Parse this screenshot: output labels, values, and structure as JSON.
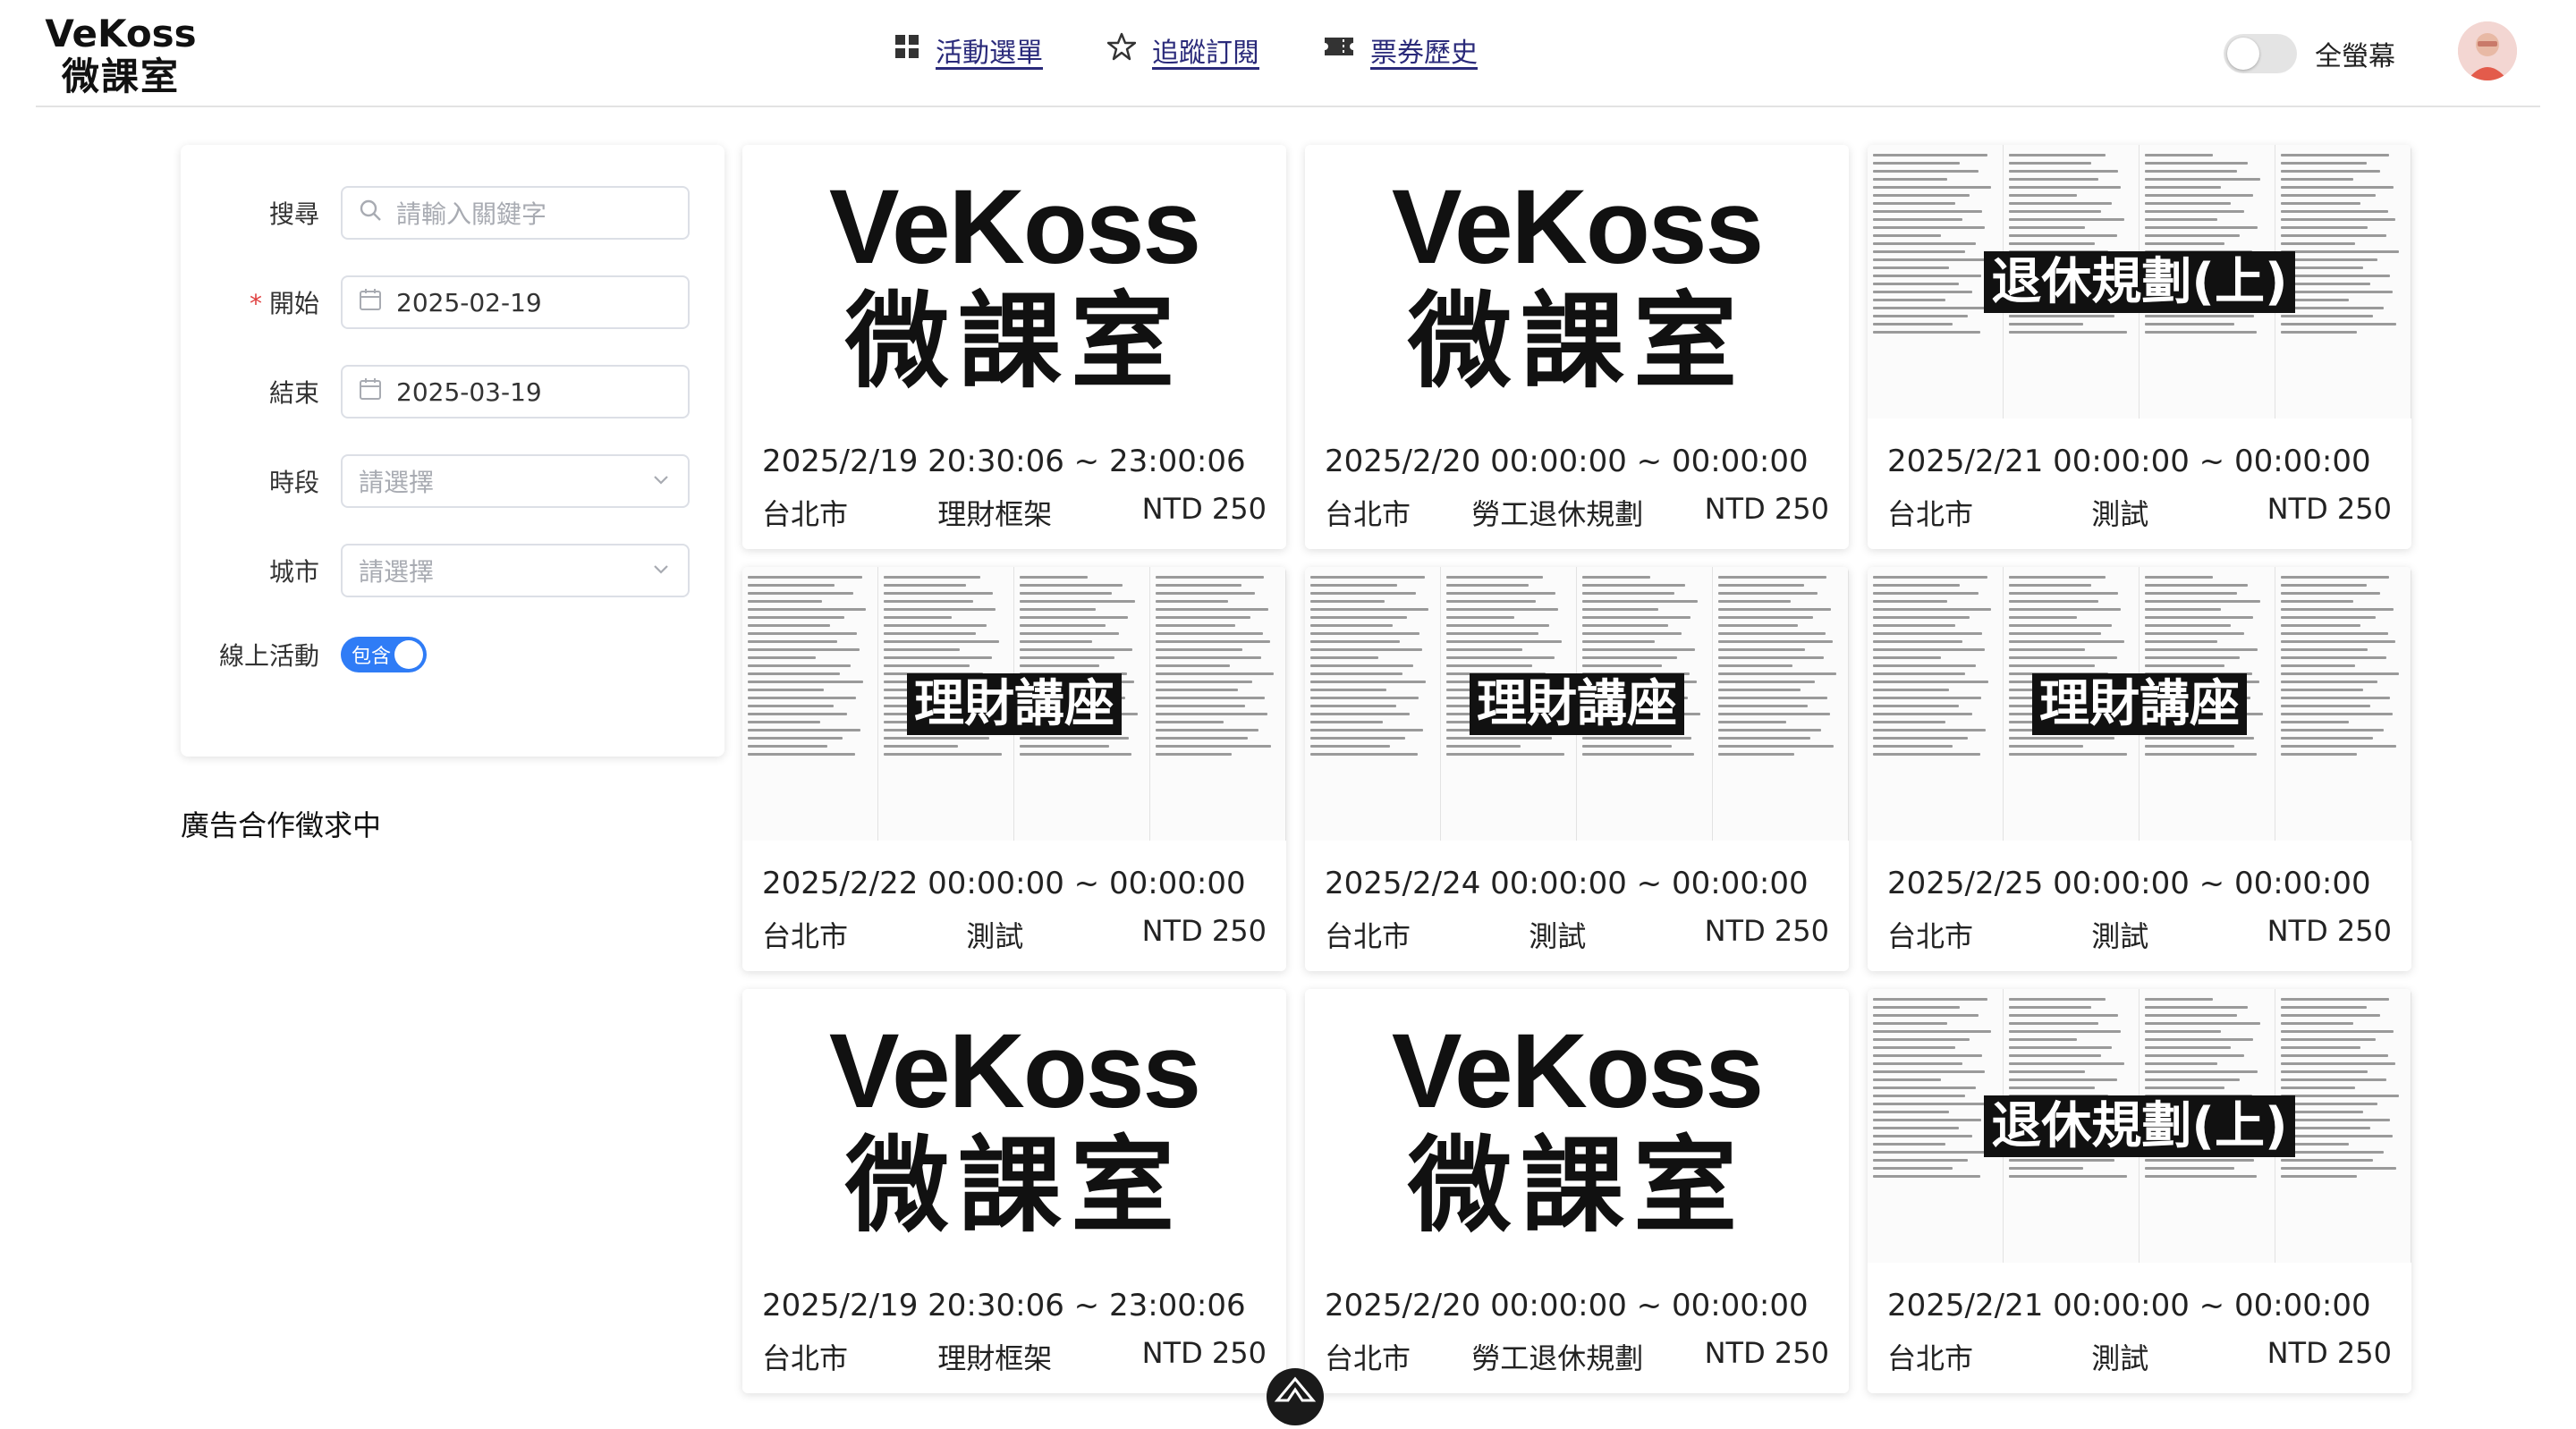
{
  "header": {
    "logo_line1": "VeKoss",
    "logo_line2": "微課室",
    "nav": [
      {
        "label": "活動選單",
        "icon": "grid-icon"
      },
      {
        "label": "追蹤訂閱",
        "icon": "star-icon"
      },
      {
        "label": "票券歷史",
        "icon": "ticket-icon"
      }
    ],
    "fullscreen_label": "全螢幕",
    "fullscreen_on": false
  },
  "filters": {
    "search": {
      "label": "搜尋",
      "placeholder": "請輸入關鍵字"
    },
    "start": {
      "label": "開始",
      "required_mark": "*",
      "value": "2025-02-19"
    },
    "end": {
      "label": "結束",
      "value": "2025-03-19"
    },
    "period": {
      "label": "時段",
      "placeholder": "請選擇"
    },
    "city": {
      "label": "城市",
      "placeholder": "請選擇"
    },
    "online": {
      "label": "線上活動",
      "toggle_text": "包含",
      "on": true
    }
  },
  "ad_text": "廣告合作徵求中",
  "events": [
    {
      "thumb": "logo",
      "brand1": "VeKoss",
      "brand2": "微課室",
      "overlay": "",
      "time": "2025/2/19 20:30:06 ~ 23:00:06",
      "city": "台北市",
      "category": "理財框架",
      "price": "NTD 250"
    },
    {
      "thumb": "logo",
      "brand1": "VeKoss",
      "brand2": "微課室",
      "overlay": "",
      "time": "2025/2/20 00:00:00 ~ 00:00:00",
      "city": "台北市",
      "category": "勞工退休規劃",
      "price": "NTD 250"
    },
    {
      "thumb": "text",
      "brand1": "",
      "brand2": "",
      "overlay": "退休規劃(上)",
      "time": "2025/2/21 00:00:00 ~ 00:00:00",
      "city": "台北市",
      "category": "測試",
      "price": "NTD 250"
    },
    {
      "thumb": "text",
      "brand1": "",
      "brand2": "",
      "overlay": "理財講座",
      "time": "2025/2/22 00:00:00 ~ 00:00:00",
      "city": "台北市",
      "category": "測試",
      "price": "NTD 250"
    },
    {
      "thumb": "text",
      "brand1": "",
      "brand2": "",
      "overlay": "理財講座",
      "time": "2025/2/24 00:00:00 ~ 00:00:00",
      "city": "台北市",
      "category": "測試",
      "price": "NTD 250"
    },
    {
      "thumb": "text",
      "brand1": "",
      "brand2": "",
      "overlay": "理財講座",
      "time": "2025/2/25 00:00:00 ~ 00:00:00",
      "city": "台北市",
      "category": "測試",
      "price": "NTD 250"
    },
    {
      "thumb": "logo",
      "brand1": "VeKoss",
      "brand2": "微課室",
      "overlay": "",
      "time": "2025/2/19 20:30:06 ~ 23:00:06",
      "city": "台北市",
      "category": "理財框架",
      "price": "NTD 250"
    },
    {
      "thumb": "logo",
      "brand1": "VeKoss",
      "brand2": "微課室",
      "overlay": "",
      "time": "2025/2/20 00:00:00 ~ 00:00:00",
      "city": "台北市",
      "category": "勞工退休規劃",
      "price": "NTD 250"
    },
    {
      "thumb": "text",
      "brand1": "",
      "brand2": "",
      "overlay": "退休規劃(上)",
      "time": "2025/2/21 00:00:00 ~ 00:00:00",
      "city": "台北市",
      "category": "測試",
      "price": "NTD 250"
    }
  ],
  "colors": {
    "accent": "#2f7cf6",
    "nav_text": "#2a2a7a",
    "required": "#e04040"
  }
}
